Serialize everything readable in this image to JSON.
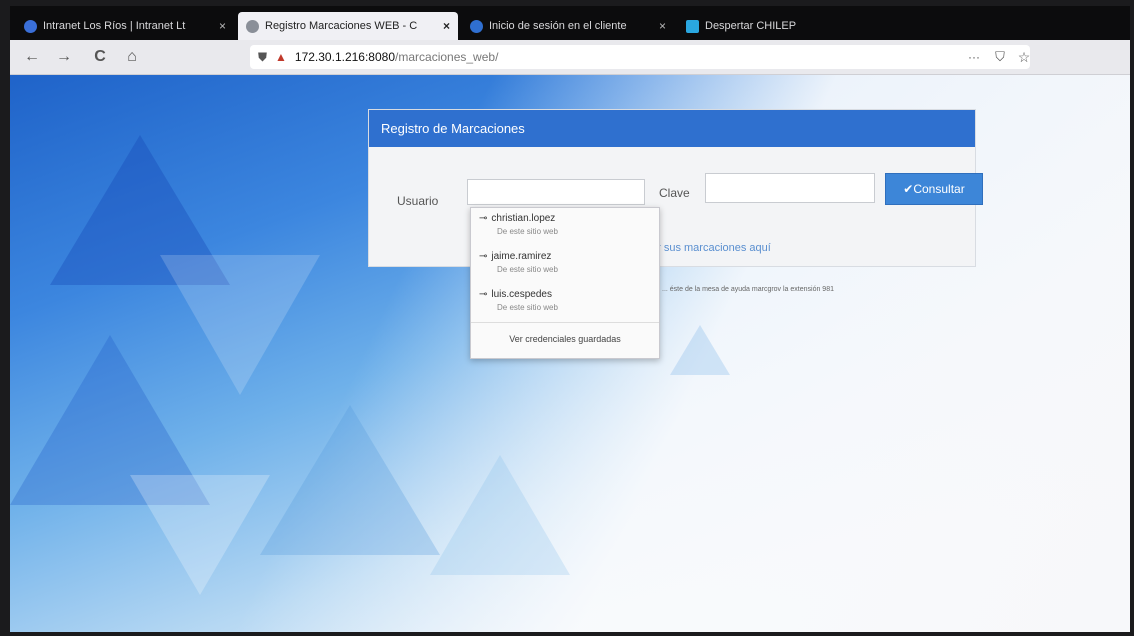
{
  "browser": {
    "tabs": [
      {
        "label": "Intranet Los Ríos | Intranet Lt",
        "close": "×",
        "favicon_color": "#3a6fd8"
      },
      {
        "label": "Registro Marcaciones WEB - C",
        "close": "×",
        "favicon_color": "#8a8f98",
        "active": true
      },
      {
        "label": "Inicio de sesión en el cliente",
        "close": "×",
        "favicon_color": "#2f6fd0"
      },
      {
        "label": "Despertar CHILEP",
        "close": "",
        "favicon_color": "#2aa7e0"
      }
    ],
    "address": {
      "host": "172.30.1.216:8080",
      "path": "/marcaciones_web/"
    },
    "nav": {
      "back": "←",
      "forward": "→",
      "reload": "C",
      "home": "⌂",
      "more": "···",
      "pocket": "⛉",
      "star": "☆"
    }
  },
  "panel": {
    "title": "Registro de Marcaciones",
    "usuario_label": "Usuario",
    "usuario_value": "",
    "clave_label": "Clave",
    "clave_value": "",
    "submit_label": "✔Consultar",
    "link_text": "ar sus marcaciones aquí"
  },
  "note": "... éste de la mesa de ayuda marcgrov la extensión 981",
  "autocomplete": {
    "items": [
      {
        "user": "christian.lopez",
        "sub": "De este sitio web"
      },
      {
        "user": "jaime.ramirez",
        "sub": "De este sitio web"
      },
      {
        "user": "luis.cespedes",
        "sub": "De este sitio web"
      }
    ],
    "footer": "Ver credenciales guardadas",
    "key_icon": "⊸"
  },
  "colors": {
    "header_blue": "#2f70cf",
    "button_blue": "#3d86d8"
  }
}
